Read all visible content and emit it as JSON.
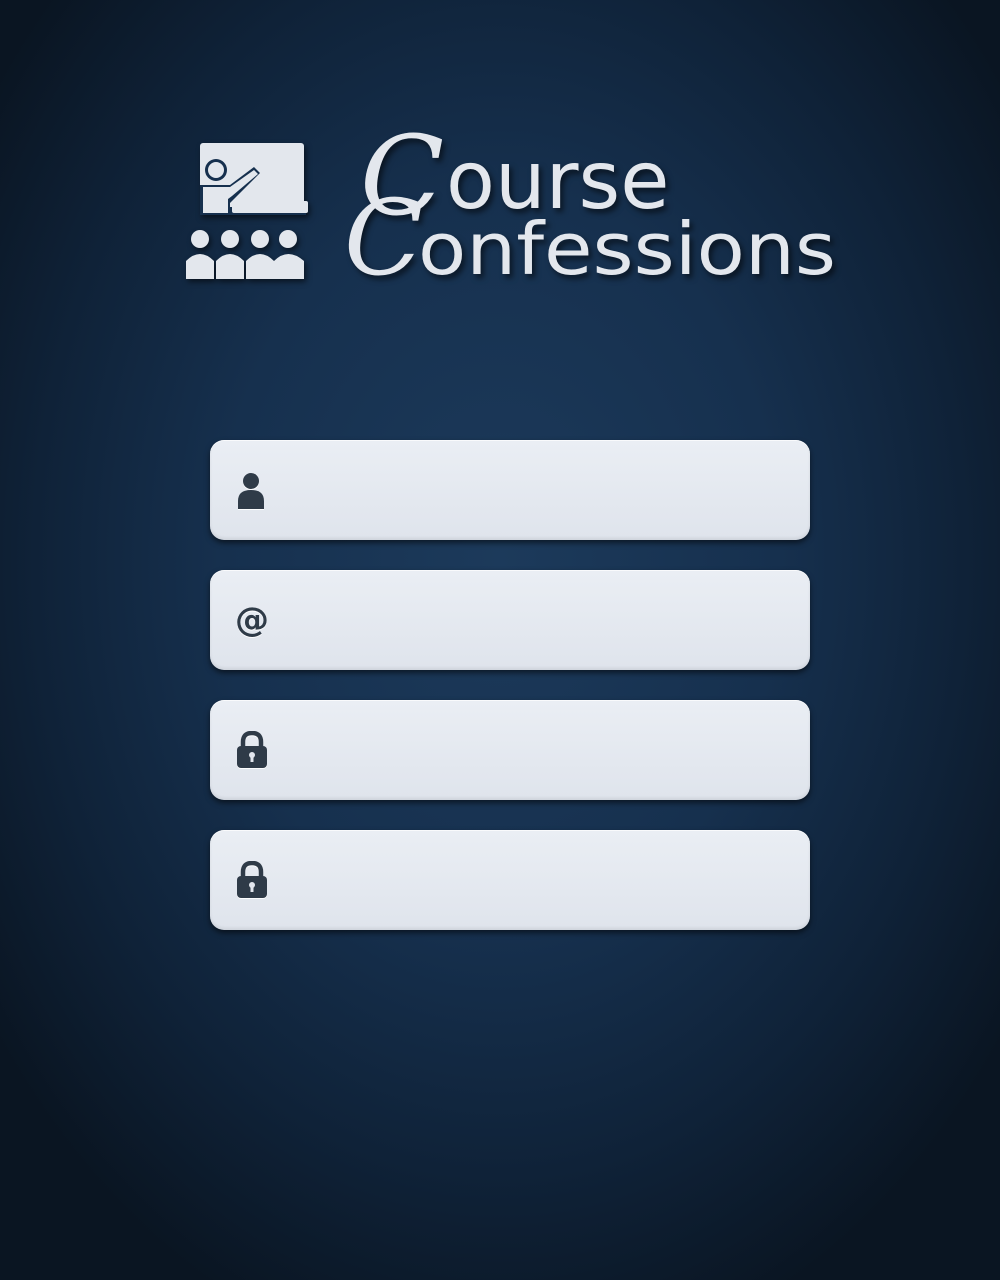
{
  "logo": {
    "line1_cap": "C",
    "line1_rest": "ourse",
    "line2_cap": "C",
    "line2_rest": "onfessions",
    "emblem_icon": "classroom-teacher-icon"
  },
  "fields": [
    {
      "icon": "user-icon",
      "value": "",
      "placeholder": ""
    },
    {
      "icon": "at-sign-icon",
      "glyph": "@",
      "value": "",
      "placeholder": ""
    },
    {
      "icon": "lock-icon",
      "value": "",
      "placeholder": ""
    },
    {
      "icon": "lock-icon",
      "value": "",
      "placeholder": ""
    }
  ],
  "colors": {
    "background": "#16304e",
    "field": "#e3e7ee",
    "icon": "#2f3b48",
    "logo": "#e3e7ed"
  }
}
